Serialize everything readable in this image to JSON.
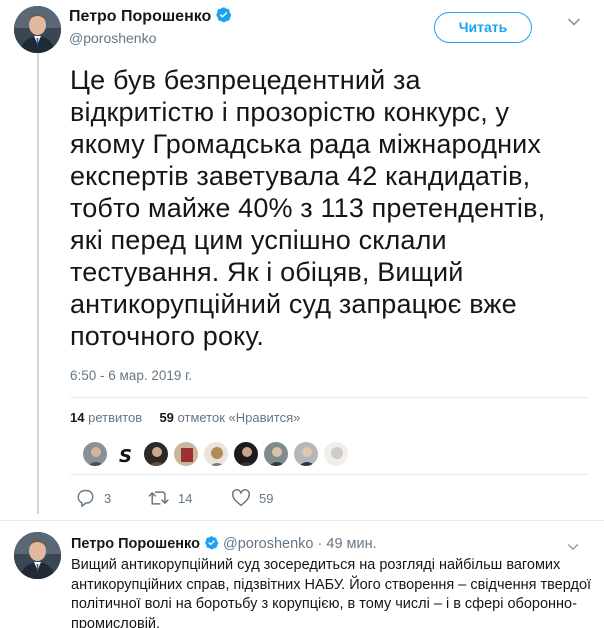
{
  "tweet": {
    "author_name": "Петро Порошенко",
    "handle": "@poroshenko",
    "follow_label": "Читать",
    "text_lines": [
      "Це був безпрецедентний за",
      "відкритістю і прозорістю конкурс, у",
      "якому Громадська рада міжнародних",
      "експертів заветувала 42 кандидатів,",
      "тобто майже 40% з 113 претендентів,",
      "які перед цим успішно склали",
      "тестування. Як і обіцяв, Вищий",
      "антикорупційний суд запрацює вже",
      "поточного року."
    ],
    "timestamp": "6:50 - 6 мар. 2019 г.",
    "retweets_count": "14",
    "retweets_label": "ретвитов",
    "likes_count": "59",
    "likes_label": "отметок «Нравится»",
    "reply_count": "3",
    "retweet_count_action": "14",
    "like_count_action": "59"
  },
  "reply": {
    "author_name": "Петро Порошенко",
    "handle": "@poroshenko",
    "time": "· 49 мин.",
    "text_lines": [
      "Вищий антикорупційний суд зосередиться на розгляді найбільш вагомих",
      "антикорупційних справ, підзвітних НАБУ. Його створення – свідчення твердої",
      "політичної волі на боротьбу з корупцією, в тому числі – і в сфері оборонно-",
      "промисловій."
    ]
  },
  "icons": {
    "verified": "verified-badge-icon",
    "caret": "chevron-down-icon",
    "reply": "reply-icon",
    "retweet": "retweet-icon",
    "like": "heart-icon"
  },
  "colors": {
    "accent": "#1da1f2",
    "muted": "#657786",
    "text": "#14171a",
    "divider": "#e6ecf0"
  }
}
